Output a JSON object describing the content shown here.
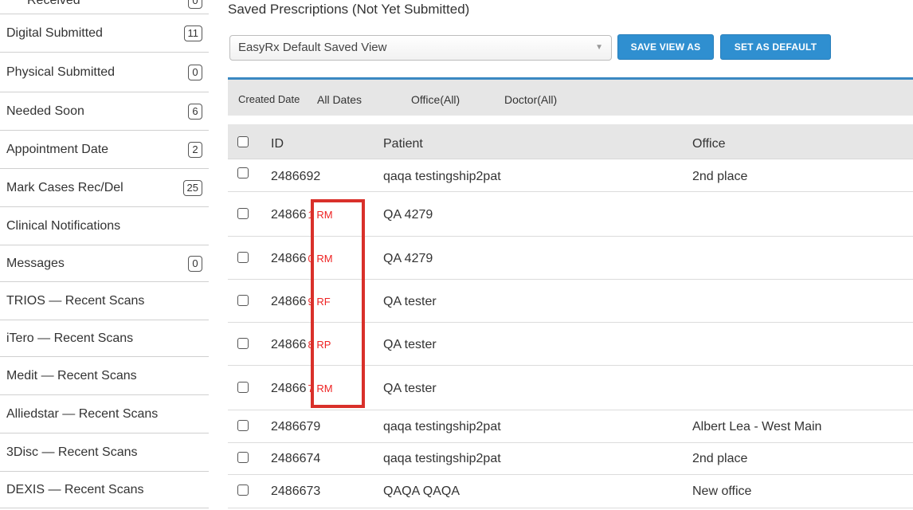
{
  "sidebar": {
    "items": [
      {
        "label": "Received",
        "count": "0"
      },
      {
        "label": "Digital Submitted",
        "count": "11"
      },
      {
        "label": "Physical Submitted",
        "count": "0"
      },
      {
        "label": "Needed Soon",
        "count": "6"
      },
      {
        "label": "Appointment Date",
        "count": "2"
      },
      {
        "label": "Mark Cases Rec/Del",
        "count": "25"
      },
      {
        "label": "Clinical Notifications",
        "count": null
      },
      {
        "label": "Messages",
        "count": "0"
      },
      {
        "label": "TRIOS — Recent Scans",
        "count": null
      },
      {
        "label": "iTero — Recent Scans",
        "count": null
      },
      {
        "label": "Medit — Recent Scans",
        "count": null
      },
      {
        "label": "Alliedstar — Recent Scans",
        "count": null
      },
      {
        "label": "3Disc — Recent Scans",
        "count": null
      },
      {
        "label": "DEXIS — Recent Scans",
        "count": null
      }
    ]
  },
  "main": {
    "title": "Saved Prescriptions (Not Yet Submitted)",
    "view_select": "EasyRx Default Saved View",
    "save_view_as": "SAVE VIEW AS",
    "set_as_default": "SET AS DEFAULT",
    "filters": {
      "created_date_label": "Created Date",
      "created_date_value": "All Dates",
      "office": "Office(All)",
      "doctor": "Doctor(All)"
    },
    "columns": {
      "id": "ID",
      "patient": "Patient",
      "office": "Office"
    },
    "rows": [
      {
        "id": "2486692",
        "tag": "",
        "patient": "qaqa testingship2pat",
        "office": "2nd place"
      },
      {
        "id": "24866",
        "tag": "1 RM",
        "patient": "QA 4279",
        "office": ""
      },
      {
        "id": "24866",
        "tag": "0 RM",
        "patient": "QA 4279",
        "office": ""
      },
      {
        "id": "24866",
        "tag": "9 RF",
        "patient": "QA tester",
        "office": ""
      },
      {
        "id": "24866",
        "tag": "8 RP",
        "patient": "QA tester",
        "office": ""
      },
      {
        "id": "24866",
        "tag": "7 RM",
        "patient": "QA tester",
        "office": ""
      },
      {
        "id": "2486679",
        "tag": "",
        "patient": "qaqa testingship2pat",
        "office": "Albert Lea - West Main"
      },
      {
        "id": "2486674",
        "tag": "",
        "patient": "qaqa testingship2pat",
        "office": "2nd place"
      },
      {
        "id": "2486673",
        "tag": "",
        "patient": "QAQA QAQA",
        "office": "New office"
      }
    ]
  },
  "colors": {
    "accent": "#2f8fd0",
    "highlight": "#d9302a",
    "tag": "#ee2222"
  }
}
